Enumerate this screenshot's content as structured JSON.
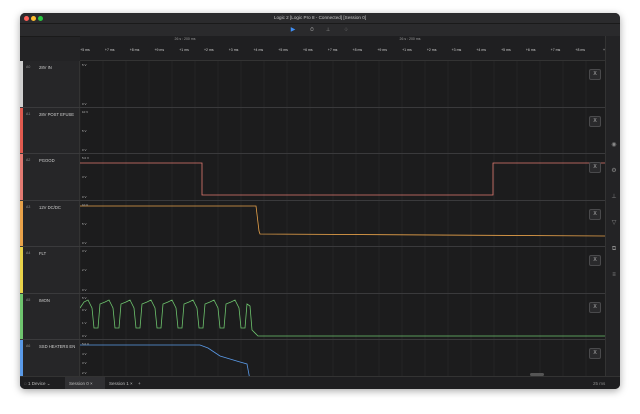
{
  "window": {
    "title": "Logic 2 [Logic Pro 8 - Connected] [Session 0]"
  },
  "toolbar": {
    "play_icon": "▶",
    "timer_icon": "⏱",
    "analyzer_icon": "⊥",
    "trigger_icon": "♢"
  },
  "ruler": {
    "main_labels": [
      "26 s : 200 ms",
      "26 s : 200 ms"
    ],
    "tick_labels": [
      "+5 ms",
      "+7 ms",
      "+8 ms",
      "+9 ms",
      "+1 ms",
      "+2 ms",
      "+3 ms",
      "+4 ms",
      "+5 ms",
      "+6 ms",
      "+7 ms",
      "+8 ms",
      "+9 ms",
      "+1 ms",
      "+2 ms",
      "+3 ms",
      "+4 ms",
      "+5 ms",
      "+6 ms",
      "+7 ms",
      "+8 ms",
      "+9"
    ]
  },
  "channels": [
    {
      "num": "A0",
      "name": "28V IN",
      "color": "#d0d0d0",
      "y_labels": [
        "5 V",
        "0 V"
      ]
    },
    {
      "num": "A1",
      "name": "28V POST EFUSE",
      "color": "#e05a4f",
      "y_labels": [
        "10 V",
        "5 V",
        "0 V"
      ]
    },
    {
      "num": "A2",
      "name": "PGOOD",
      "color": "#e27a72",
      "y_labels": [
        "5.0 V",
        "3 V",
        "0 V"
      ]
    },
    {
      "num": "A3",
      "name": "12V DC/DC",
      "color": "#e8a24a",
      "y_labels": [
        "10 V",
        "5 V",
        "0 V"
      ]
    },
    {
      "num": "A4",
      "name": "FLT",
      "color": "#e8d24a",
      "y_labels": [
        "3 V",
        "2 V",
        "0 V"
      ]
    },
    {
      "num": "A5",
      "name": "IMON",
      "color": "#6ec46e",
      "y_labels": [
        "5 V",
        "0 V",
        "1 V",
        "0 V"
      ]
    },
    {
      "num": "A6",
      "name": "SSD HEATERS EN",
      "color": "#5a9ae8",
      "y_labels": [
        "5.0 V",
        "4 V",
        "3 V",
        "2 V",
        "1 V"
      ]
    }
  ],
  "channel_button": "X",
  "sidebar_icons": [
    "eye-icon",
    "gear-icon",
    "tree-icon",
    "filter-icon",
    "layers-icon",
    "notes-icon"
  ],
  "bottom": {
    "device_label": "1 Device",
    "tabs": [
      {
        "label": "Session 0",
        "active": true
      },
      {
        "label": "Session 1",
        "active": false
      }
    ],
    "add_label": "+",
    "zoom_label": "25 ms"
  }
}
